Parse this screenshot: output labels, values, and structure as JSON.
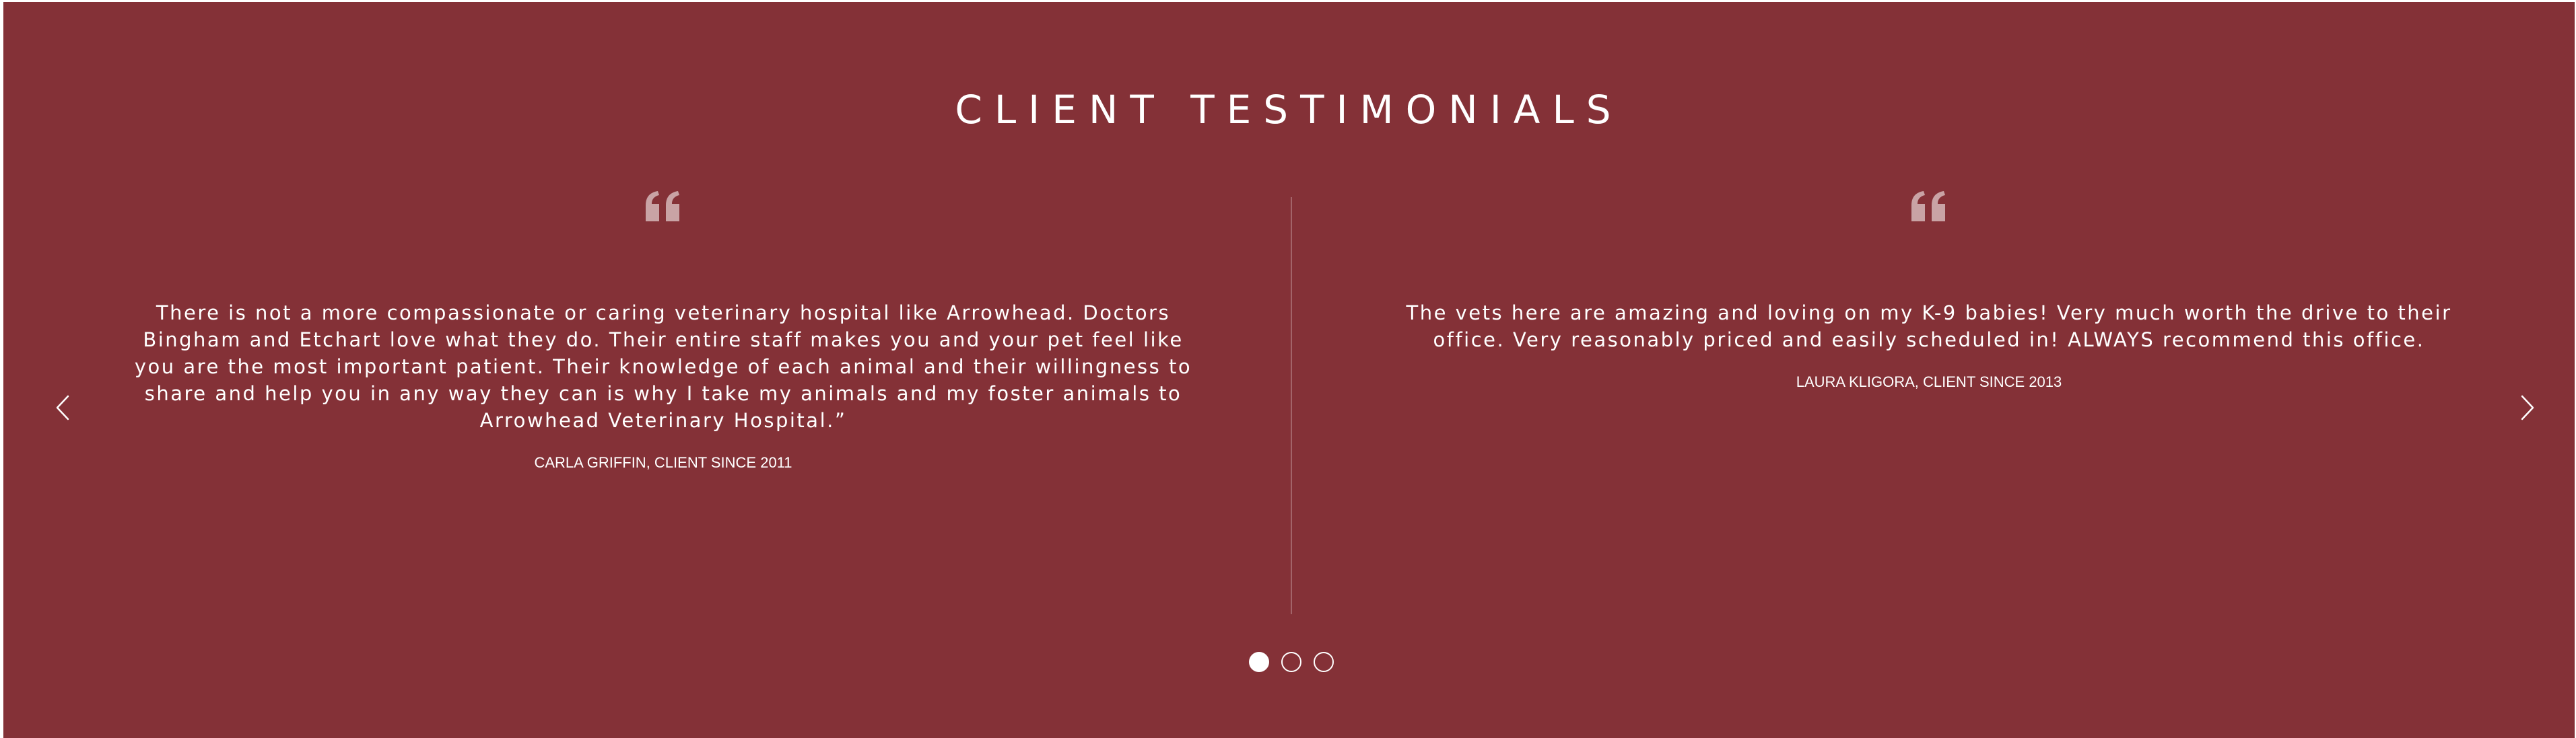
{
  "section": {
    "title": "CLIENT TESTIMONIALS",
    "background_color": "#843137",
    "text_color": "#ffffff",
    "quote_color": "#c9a3a5"
  },
  "testimonials": [
    {
      "quote": "There is not a more compassionate or caring veterinary hospital like Arrowhead. Doctors Bingham and Etchart love what they do. Their entire staff makes you and your pet feel like you are the most important patient. Their knowledge of each animal and their willingness to share and help you in any way they can is why I take my animals and my foster animals to Arrowhead Veterinary Hospital.”",
      "author": "CARLA GRIFFIN, CLIENT SINCE 2011",
      "icon": "quote-icon"
    },
    {
      "quote": "The vets here are amazing and loving on my K-9 babies! Very much worth the drive to their office. Very reasonably priced and easily scheduled in! ALWAYS recommend this office.",
      "author": "LAURA KLIGORA, CLIENT SINCE 2013",
      "icon": "quote-icon"
    }
  ],
  "navigation": {
    "prev_icon": "chevron-left-icon",
    "next_icon": "chevron-right-icon",
    "page_count": 3,
    "active_page": 1
  }
}
